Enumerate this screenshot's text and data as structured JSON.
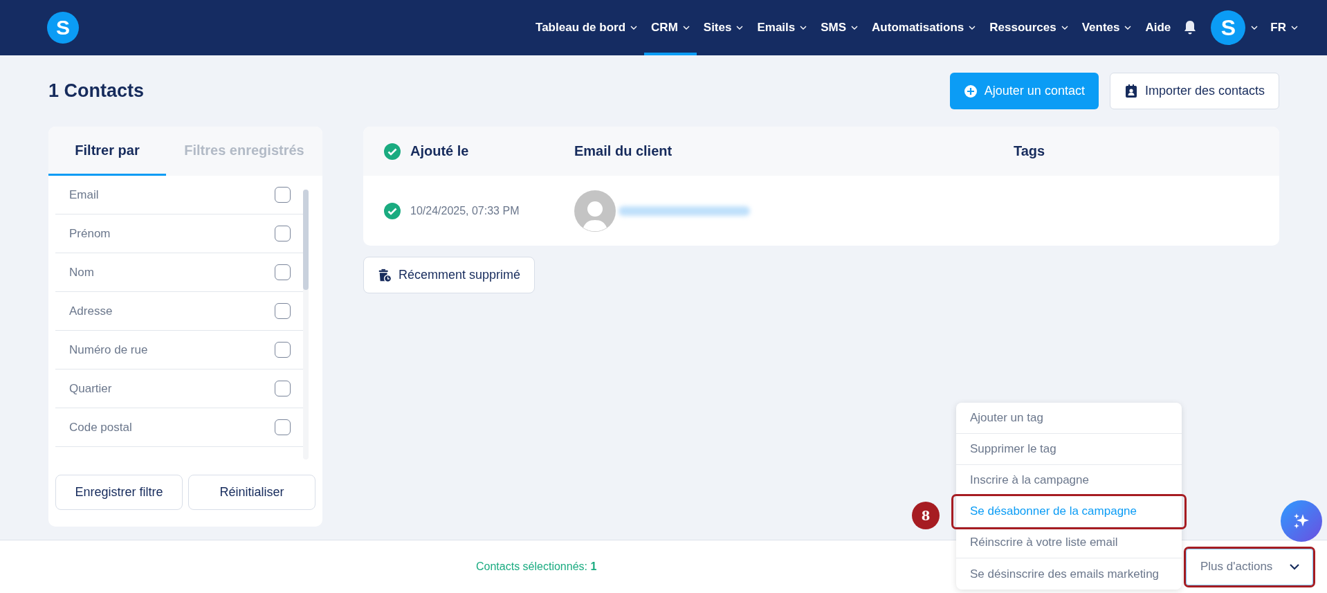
{
  "nav": {
    "logo": "S",
    "items": [
      {
        "label": "Tableau de bord",
        "has_menu": true,
        "selected": false
      },
      {
        "label": "CRM",
        "has_menu": true,
        "selected": true
      },
      {
        "label": "Sites",
        "has_menu": true,
        "selected": false
      },
      {
        "label": "Emails",
        "has_menu": true,
        "selected": false
      },
      {
        "label": "SMS",
        "has_menu": true,
        "selected": false
      },
      {
        "label": "Automatisations",
        "has_menu": true,
        "selected": false
      },
      {
        "label": "Ressources",
        "has_menu": true,
        "selected": false
      },
      {
        "label": "Ventes",
        "has_menu": true,
        "selected": false
      },
      {
        "label": "Aide",
        "has_menu": false,
        "selected": false
      }
    ],
    "avatar": "S",
    "language": "FR"
  },
  "page_title": "1 Contacts",
  "header_buttons": [
    {
      "label": "Ajouter un contact",
      "kind": "primary"
    },
    {
      "label": "Importer des contacts",
      "kind": "secondary"
    }
  ],
  "filter_panel": {
    "tabs": [
      {
        "label": "Filtrer par",
        "selected": true
      },
      {
        "label": "Filtres enregistrés",
        "selected": false
      }
    ],
    "filters": [
      {
        "label": "Email",
        "checked": false
      },
      {
        "label": "Prénom",
        "checked": false
      },
      {
        "label": "Nom",
        "checked": false
      },
      {
        "label": "Adresse",
        "checked": false
      },
      {
        "label": "Numéro de rue",
        "checked": false
      },
      {
        "label": "Quartier",
        "checked": false
      },
      {
        "label": "Code postal",
        "checked": false
      }
    ],
    "buttons": [
      "Enregistrer filtre",
      "Réinitialiser"
    ]
  },
  "table": {
    "select_all": true,
    "columns": [
      "Ajouté le",
      "Email du client",
      "Tags"
    ],
    "rows": [
      {
        "selected": true,
        "added": "10/24/2025, 07:33 PM"
      }
    ]
  },
  "recently_deleted_button": "Récemment supprimé",
  "footer": {
    "selection_text": "Contacts sélectionnés: **1**",
    "actions_button": {
      "label": "Plus d'actions",
      "highlighted": true
    }
  },
  "actions_menu": [
    {
      "label": "Ajouter un tag",
      "selected": false,
      "highlighted": false
    },
    {
      "label": "Supprimer le tag",
      "selected": false,
      "highlighted": false
    },
    {
      "label": "Inscrire à la campagne",
      "selected": false,
      "highlighted": false
    },
    {
      "label": "Se désabonner de la campagne",
      "selected": true,
      "highlighted": true
    },
    {
      "label": "Réinscrire à votre liste email",
      "selected": false,
      "highlighted": false
    },
    {
      "label": "Se désinscrire des emails marketing",
      "selected": false,
      "highlighted": false
    }
  ],
  "step_marker": "8"
}
